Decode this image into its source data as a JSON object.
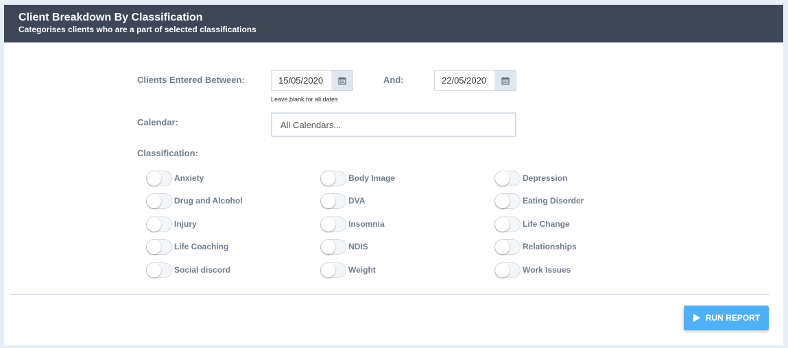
{
  "header": {
    "title": "Client Breakdown By Classification",
    "subtitle": "Categorises clients who are a part of selected classifications"
  },
  "form": {
    "entered_between_label": "Clients Entered Between:",
    "start_date": "15/05/2020",
    "and_label": "And:",
    "end_date": "22/05/2020",
    "date_hint": "Leave blank for all dates",
    "calendar_label": "Calendar:",
    "calendar_value": "All Calendars...",
    "classification_label": "Classification:"
  },
  "classifications": [
    {
      "label": "Anxiety",
      "on": false
    },
    {
      "label": "Body Image",
      "on": false
    },
    {
      "label": "Depression",
      "on": false
    },
    {
      "label": "Drug and Alcohol",
      "on": false
    },
    {
      "label": "DVA",
      "on": false
    },
    {
      "label": "Eating Disorder",
      "on": false
    },
    {
      "label": "Injury",
      "on": false
    },
    {
      "label": "Insomnia",
      "on": false
    },
    {
      "label": "Life Change",
      "on": false
    },
    {
      "label": "Life Coaching",
      "on": false
    },
    {
      "label": "NDIS",
      "on": false
    },
    {
      "label": "Relationships",
      "on": false
    },
    {
      "label": "Social discord",
      "on": false
    },
    {
      "label": "Weight",
      "on": false
    },
    {
      "label": "Work Issues",
      "on": false
    }
  ],
  "actions": {
    "run_report_label": "RUN REPORT"
  },
  "colors": {
    "header_bg": "#3e4658",
    "label_text": "#6f7d8e",
    "accent": "#4fb0f5",
    "page_bg": "#e8eef6"
  },
  "icons": {
    "date_picker": "calendar-icon",
    "run": "play-icon"
  }
}
